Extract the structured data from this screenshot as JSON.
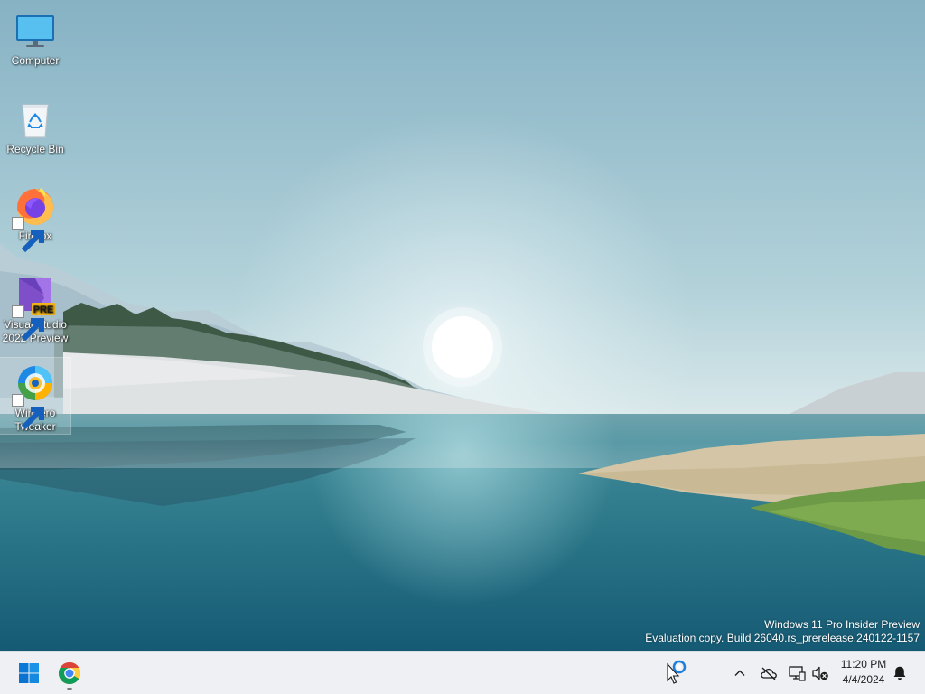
{
  "desktop": {
    "icons": [
      {
        "label": "Computer",
        "icon": "computer-icon"
      },
      {
        "label": "Recycle Bin",
        "icon": "recycle-bin-icon"
      },
      {
        "label": "Firefox",
        "icon": "firefox-icon",
        "shortcut": true
      },
      {
        "label": "Visual Studio 2022 Preview",
        "icon": "visual-studio-preview-icon",
        "shortcut": true,
        "badge": "PRE"
      },
      {
        "label": "Winaero Tweaker",
        "icon": "winaero-tweaker-icon",
        "shortcut": true,
        "selected": true
      }
    ],
    "wallpaper": "lake-landscape-with-sun",
    "watermark": {
      "line1": "Windows 11 Pro Insider Preview",
      "line2": "Evaluation copy. Build 26040.rs_prerelease.240122-1157"
    }
  },
  "taskbar": {
    "start_icon": "windows-start-icon",
    "pinned": [
      {
        "icon": "chrome-icon",
        "running": true
      }
    ],
    "tray": {
      "icons": [
        "copilot-icon",
        "chevron-up-icon",
        "onedrive-offline-icon",
        "network-icon",
        "volume-muted-icon"
      ]
    },
    "clock": {
      "time": "11:20 PM",
      "date": "4/4/2024"
    },
    "notification_icon": "bell-icon"
  },
  "colors": {
    "taskbar_bg": "#eef0f3",
    "accent": "#0067c0",
    "sky_top": "#88b4c6",
    "water": "#2e7f92"
  }
}
